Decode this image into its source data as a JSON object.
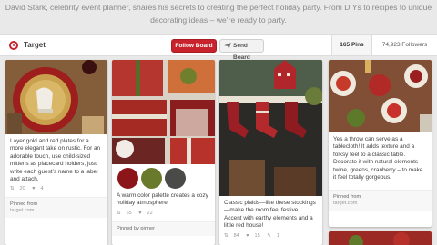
{
  "board": {
    "description": "David Stark, celebrity event planner, shares his secrets to creating the perfect holiday party. From DIYs to recipes to unique decorating ideas – we’re ready to party.",
    "owner": "Target",
    "follow_label": "Follow Board",
    "send_label": "Send Board",
    "pins_count": "165 Pins",
    "followers_count": "74,923 Followers"
  },
  "colors": {
    "brand_red": "#c8232c",
    "swatch_red": "#8c1519",
    "swatch_olive": "#6a7a2c",
    "swatch_dark": "#4a4a48"
  },
  "pins": [
    {
      "caption": "Layer gold and red plates for a more elegant take on rustic. For an adorable touch, use child-sized mittens as placecard holders, just write each guest’s name to a label and attach.",
      "repins": "20",
      "likes": "4",
      "footer_title": "Pinned from",
      "footer_source": "target.com"
    },
    {
      "caption": "A warm color palette creates a cozy holiday atmosphere.",
      "repins": "65",
      "likes": "22",
      "footer_title": "Pinned by pinner",
      "footer_source": ""
    },
    {
      "caption": "Classic plaids—like these stockings—make the room feel festive. Accent with earthy elements and a little red house!",
      "repins": "84",
      "likes": "15",
      "comments": "1",
      "footer_title": "",
      "footer_source": ""
    },
    {
      "caption": "Yes a throw can serve as a tablecloth! It adds texture and a folksy feel to a classic table. Decorate it with natural elements – twine, greens, cranberry – to make it feel totally gorgeous.",
      "repins": "",
      "likes": "",
      "footer_title": "Pinned from",
      "footer_source": "target.com"
    }
  ]
}
